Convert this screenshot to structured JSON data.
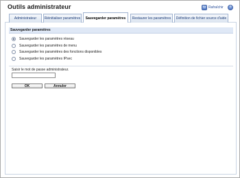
{
  "header": {
    "title": "Outils administrateur",
    "refresh_label": "Rafraîchir",
    "refresh_icon": "refresh-icon",
    "help_icon": "help-icon"
  },
  "tabs": [
    {
      "label": "Administrateur",
      "active": false
    },
    {
      "label": "Réinitialiser paramètres",
      "active": false
    },
    {
      "label": "Sauvegarder paramètres",
      "active": true
    },
    {
      "label": "Restaurer les paramètres",
      "active": false
    },
    {
      "label": "Définition de fichier source d'aide",
      "active": false
    }
  ],
  "section": {
    "title": "Sauvegarder paramètres",
    "options": [
      {
        "label": "Sauvegarder les paramètres réseau",
        "checked": true
      },
      {
        "label": "Sauvegarder les paramètres de menu",
        "checked": false
      },
      {
        "label": "Sauvegarder les paramètres des fonctions disponibles",
        "checked": false
      },
      {
        "label": "Sauvegarder les paramètres IPsec",
        "checked": false
      }
    ]
  },
  "password": {
    "label": "Saisir le mot de passe administrateur.",
    "value": ""
  },
  "buttons": {
    "ok": "OK",
    "cancel": "Annuler"
  },
  "colors": {
    "section_bg": "#dfe8f6",
    "tab_text": "#1d3c78",
    "border": "#c9d4e4"
  }
}
